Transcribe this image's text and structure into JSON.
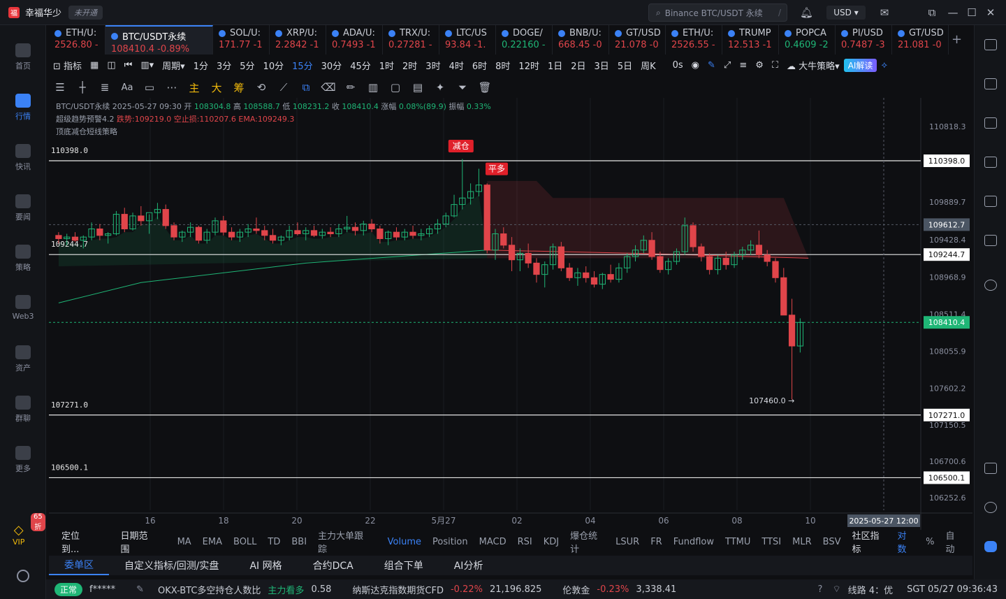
{
  "app": {
    "name": "幸福华少",
    "badge": "未开通",
    "search_placeholder": "Binance BTC/USDT 永续",
    "currency": "USD"
  },
  "sidebar": [
    {
      "label": "首页",
      "active": false
    },
    {
      "label": "行情",
      "active": true
    },
    {
      "label": "快讯",
      "active": false
    },
    {
      "label": "要闻",
      "active": false
    },
    {
      "label": "策略",
      "active": false
    },
    {
      "label": "Web3",
      "active": false
    },
    {
      "label": "资产",
      "active": false
    },
    {
      "label": "群聊",
      "active": false
    },
    {
      "label": "更多",
      "active": false
    }
  ],
  "vip": {
    "label": "VIP",
    "discount": "65折"
  },
  "tabs": [
    {
      "name": "ETH/U:",
      "price": "2526.80",
      "chg": "-",
      "up": false
    },
    {
      "name": "BTC/USDT永续",
      "price": "108410.4",
      "chg": "-0.89%",
      "up": false,
      "active": true
    },
    {
      "name": "SOL/U:",
      "price": "171.77",
      "chg": "-1",
      "up": false
    },
    {
      "name": "XRP/U:",
      "price": "2.2842",
      "chg": "-1",
      "up": false
    },
    {
      "name": "ADA/U:",
      "price": "0.7493",
      "chg": "-1",
      "up": false
    },
    {
      "name": "TRX/U:",
      "price": "0.27281",
      "chg": "-",
      "up": false
    },
    {
      "name": "LTC/US",
      "price": "93.84",
      "chg": "-1.",
      "up": false
    },
    {
      "name": "DOGE/",
      "price": "0.22160",
      "chg": "-",
      "up": true
    },
    {
      "name": "BNB/U:",
      "price": "668.45",
      "chg": "-0",
      "up": false
    },
    {
      "name": "GT/USD",
      "price": "21.078",
      "chg": "-0",
      "up": false
    },
    {
      "name": "ETH/U:",
      "price": "2526.55",
      "chg": "-",
      "up": false
    },
    {
      "name": "TRUMP",
      "price": "12.513",
      "chg": "-1",
      "up": false
    },
    {
      "name": "POPCA",
      "price": "0.4609",
      "chg": "-2",
      "up": true
    },
    {
      "name": "PI/USD",
      "price": "0.7487",
      "chg": "-3",
      "up": false
    },
    {
      "name": "GT/USD",
      "price": "21.081",
      "chg": "-0",
      "up": false
    }
  ],
  "toolbar": {
    "indicator": "指标",
    "period": "周期",
    "timeframes": [
      "1分",
      "3分",
      "5分",
      "10分",
      "15分",
      "30分",
      "45分",
      "1时",
      "2时",
      "3时",
      "4时",
      "6时",
      "8时",
      "12时",
      "1日",
      "2日",
      "3日",
      "5日",
      "周K"
    ],
    "active_tf": "15分",
    "countdown": "0s",
    "strategy": "大牛策略",
    "ai": "AI解读"
  },
  "drawtools": [
    "主",
    "大",
    "筹"
  ],
  "info": {
    "line1": "BTC/USDT永续 2025-05-27 09:30",
    "open_label": "开",
    "open": "108304.8",
    "high_label": "高",
    "high": "108588.7",
    "low_label": "低",
    "low": "108231.2",
    "close_label": "收",
    "close": "108410.4",
    "change_label": "涨幅",
    "change": "0.08%(89.9)",
    "amp_label": "振幅",
    "amp": "0.33%",
    "line2a": "超级趋势预警4.2",
    "line2b": "跌势:109219.0",
    "line2c": "空止损:110207.6",
    "line2d": "EMA:109249.3",
    "line3": "顶底减仓短线策略"
  },
  "chart_data": {
    "type": "candlestick",
    "symbol": "BTC/USDT永续",
    "interval": "15分",
    "y_ticks": [
      110818.3,
      110398.0,
      109889.7,
      109612.7,
      109428.4,
      109244.7,
      108968.9,
      108511.4,
      108410.4,
      108055.9,
      107602.2,
      107271.0,
      107150.5,
      106700.6,
      106500.1,
      106252.6
    ],
    "x_ticks": [
      "16",
      "18",
      "20",
      "22",
      "5月27",
      "02",
      "04",
      "06",
      "08",
      "10"
    ],
    "crosshair_time": "2025-05-27 12:00",
    "crosshair_price": 109612.7,
    "last_price": 108410.4,
    "horizontal_lines": [
      110398.0,
      109244.7,
      107271.0,
      106500.1
    ],
    "annotations": [
      {
        "text": "减仓",
        "price": 110398.0
      },
      {
        "text": "平多",
        "price": 110307.0
      },
      {
        "text": "107460.0 →",
        "price": 107460.0
      }
    ],
    "ylim": [
      106100,
      111000
    ],
    "candles": [
      [
        109480,
        109520,
        109380,
        109440
      ],
      [
        109440,
        109500,
        109360,
        109460
      ],
      [
        109460,
        109520,
        109400,
        109420
      ],
      [
        109420,
        109480,
        109320,
        109460
      ],
      [
        109460,
        109640,
        109420,
        109560
      ],
      [
        109560,
        109620,
        109420,
        109480
      ],
      [
        109480,
        109520,
        109380,
        109500
      ],
      [
        109500,
        109780,
        109480,
        109740
      ],
      [
        109740,
        109820,
        109520,
        109560
      ],
      [
        109560,
        109760,
        109540,
        109720
      ],
      [
        109720,
        109840,
        109600,
        109660
      ],
      [
        109660,
        109740,
        109500,
        109760
      ],
      [
        109760,
        109880,
        109680,
        109800
      ],
      [
        109800,
        109860,
        109560,
        109600
      ],
      [
        109600,
        109640,
        109420,
        109460
      ],
      [
        109460,
        109540,
        109400,
        109520
      ],
      [
        109520,
        109640,
        109460,
        109580
      ],
      [
        109580,
        109600,
        109380,
        109420
      ],
      [
        109420,
        109560,
        109380,
        109520
      ],
      [
        109520,
        109700,
        109480,
        109660
      ],
      [
        109660,
        109720,
        109480,
        109520
      ],
      [
        109520,
        109580,
        109420,
        109460
      ],
      [
        109460,
        109560,
        109400,
        109520
      ],
      [
        109520,
        109620,
        109460,
        109560
      ],
      [
        109560,
        109700,
        109500,
        109540
      ],
      [
        109540,
        109600,
        109420,
        109480
      ],
      [
        109480,
        109560,
        109380,
        109420
      ],
      [
        109420,
        109480,
        109360,
        109460
      ],
      [
        109460,
        109600,
        109420,
        109540
      ],
      [
        109540,
        109640,
        109480,
        109500
      ],
      [
        109500,
        109580,
        109420,
        109540
      ],
      [
        109540,
        109600,
        109460,
        109480
      ],
      [
        109480,
        109560,
        109440,
        109520
      ],
      [
        109520,
        109580,
        109460,
        109500
      ],
      [
        109500,
        109620,
        109460,
        109560
      ],
      [
        109560,
        109720,
        109520,
        109580
      ],
      [
        109580,
        109640,
        109480,
        109540
      ],
      [
        109540,
        109660,
        109480,
        109620
      ],
      [
        109620,
        109680,
        109520,
        109560
      ],
      [
        109560,
        109600,
        109380,
        109440
      ],
      [
        109440,
        109540,
        109360,
        109520
      ],
      [
        109520,
        109580,
        109420,
        109460
      ],
      [
        109460,
        109560,
        109420,
        109520
      ],
      [
        109520,
        109600,
        109440,
        109480
      ],
      [
        109480,
        109560,
        109420,
        109500
      ],
      [
        109500,
        109600,
        109460,
        109560
      ],
      [
        109560,
        109680,
        109500,
        109620
      ],
      [
        109620,
        109760,
        109580,
        109720
      ],
      [
        109720,
        109980,
        109700,
        109860
      ],
      [
        109860,
        110420,
        109800,
        109940
      ],
      [
        109940,
        110120,
        109860,
        110020
      ],
      [
        110020,
        110300,
        109960,
        110100
      ],
      [
        110100,
        110120,
        109260,
        109300
      ],
      [
        109300,
        109560,
        109180,
        109500
      ],
      [
        109500,
        109580,
        109320,
        109360
      ],
      [
        109360,
        109460,
        109040,
        109180
      ],
      [
        109180,
        109320,
        109040,
        109260
      ],
      [
        109260,
        109380,
        109080,
        109140
      ],
      [
        109140,
        109200,
        108900,
        109000
      ],
      [
        109000,
        109160,
        108840,
        109120
      ],
      [
        109120,
        109380,
        109060,
        109340
      ],
      [
        109340,
        109400,
        109040,
        109080
      ],
      [
        109080,
        109140,
        108920,
        108960
      ],
      [
        108960,
        109080,
        108860,
        109020
      ],
      [
        109020,
        109100,
        108900,
        108960
      ],
      [
        108960,
        109040,
        108840,
        108880
      ],
      [
        108880,
        109020,
        108820,
        109000
      ],
      [
        109000,
        109120,
        108900,
        108940
      ],
      [
        108940,
        109140,
        108900,
        109080
      ],
      [
        109080,
        109260,
        109020,
        109220
      ],
      [
        109220,
        109360,
        109160,
        109300
      ],
      [
        109300,
        109480,
        109260,
        109420
      ],
      [
        109420,
        109520,
        109180,
        109220
      ],
      [
        109220,
        109280,
        109020,
        109060
      ],
      [
        109060,
        109200,
        109000,
        109160
      ],
      [
        109160,
        109320,
        109120,
        109280
      ],
      [
        109280,
        109700,
        109240,
        109600
      ],
      [
        109600,
        109640,
        109280,
        109340
      ],
      [
        109340,
        109380,
        109160,
        109220
      ],
      [
        109220,
        109260,
        109000,
        109060
      ],
      [
        109060,
        109240,
        109000,
        109200
      ],
      [
        109200,
        109280,
        109060,
        109120
      ],
      [
        109120,
        109280,
        109080,
        109240
      ],
      [
        109240,
        109340,
        109180,
        109300
      ],
      [
        109300,
        109420,
        109240,
        109360
      ],
      [
        109360,
        109540,
        109200,
        109240
      ],
      [
        109240,
        109300,
        109100,
        109160
      ],
      [
        109160,
        109200,
        108900,
        108960
      ],
      [
        108960,
        109080,
        108780,
        108500
      ],
      [
        108500,
        108700,
        107460,
        108120
      ],
      [
        108120,
        108460,
        108040,
        108410
      ]
    ]
  },
  "bottom": {
    "locate": "定位到...",
    "daterange": "日期范围",
    "indicators": [
      "MA",
      "EMA",
      "BOLL",
      "TD",
      "BBI",
      "主力大单跟踪"
    ],
    "sub": [
      "Volume",
      "Position",
      "MACD",
      "RSI",
      "KDJ",
      "爆仓统计",
      "LSUR",
      "FR",
      "Fundflow",
      "TTMU",
      "TTSI",
      "MLR",
      "BSV"
    ],
    "active_sub": "Volume",
    "community": "社区指标",
    "log": "对数",
    "pct": "%",
    "auto": "自动"
  },
  "panel": {
    "tabs": [
      "委单区",
      "自定义指标/回测/实盘",
      "AI 网格",
      "合约DCA",
      "组合下单",
      "AI分析"
    ],
    "active": "委单区"
  },
  "status": {
    "ok": "正常",
    "user": "f*****",
    "ticker1": "OKX-BTC多空持仓人数比",
    "ticker1_tag": "主力看多",
    "ticker1_val": "0.58",
    "ticker2": "纳斯达克指数期货CFD",
    "ticker2_chg": "-0.22%",
    "ticker2_val": "21,196.825",
    "ticker3": "伦敦金",
    "ticker3_chg": "-0.23%",
    "ticker3_val": "3,338.41",
    "route": "线路 4：优",
    "time": "SGT 05/27 09:36:43"
  },
  "colors": {
    "up": "#1fb676",
    "down": "#e0454a",
    "accent": "#3b82f6"
  }
}
